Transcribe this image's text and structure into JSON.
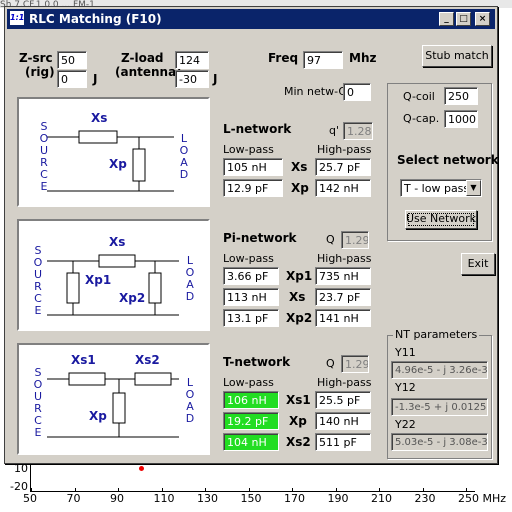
{
  "background": {
    "top_text": "Sh.7.CF.1.0.0 ... FM-1",
    "y_ticks": [
      "10",
      "-20"
    ],
    "x_ticks": [
      "50",
      "70",
      "90",
      "110",
      "130",
      "150",
      "170",
      "190",
      "210",
      "230",
      "250 MHz"
    ]
  },
  "window": {
    "title": "RLC Matching (F10)",
    "min": "_",
    "max": "□",
    "close": "×"
  },
  "zsrc": {
    "label1": "Z-src",
    "label2": "(rig)",
    "r": "50",
    "x": "0",
    "j": "J"
  },
  "zload": {
    "label1": "Z-load",
    "label2": "(antenna)",
    "r": "124",
    "x": "-30",
    "j": "J"
  },
  "freq": {
    "label": "Freq",
    "value": "97",
    "unit": "Mhz"
  },
  "minq": {
    "label": "Min netw-Q",
    "value": "0"
  },
  "stub": "Stub match",
  "qcoil": {
    "label": "Q-coil",
    "value": "250"
  },
  "qcap": {
    "label": "Q-cap.",
    "value": "1000"
  },
  "selnet": {
    "label": "Select network",
    "value": "T - low pass",
    "btn": "Use Network"
  },
  "exit": "Exit",
  "lnet": {
    "title": "L-network",
    "qlabel": "q'",
    "q": "1.28",
    "low": "Low-pass",
    "high": "High-pass",
    "r1": {
      "lo": "105 nH",
      "name": "Xs",
      "hi": "25.7 pF"
    },
    "r2": {
      "lo": "12.9 pF",
      "name": "Xp",
      "hi": "142 nH"
    },
    "d": {
      "src": "SOURCE",
      "load": "LOAD",
      "xs": "Xs",
      "xp": "Xp"
    }
  },
  "pinet": {
    "title": "Pi-network",
    "qlabel": "Q",
    "q": "1.29",
    "low": "Low-pass",
    "high": "High-pass",
    "r1": {
      "lo": "3.66 pF",
      "name": "Xp1",
      "hi": "735 nH"
    },
    "r2": {
      "lo": "113 nH",
      "name": "Xs",
      "hi": "23.7 pF"
    },
    "r3": {
      "lo": "13.1 pF",
      "name": "Xp2",
      "hi": "141 nH"
    },
    "d": {
      "src": "SOURCE",
      "load": "LOAD",
      "xs": "Xs",
      "xp1": "Xp1",
      "xp2": "Xp2"
    }
  },
  "tnet": {
    "title": "T-network",
    "qlabel": "Q",
    "q": "1.29",
    "low": "Low-pass",
    "high": "High-pass",
    "r1": {
      "lo": "106 nH",
      "name": "Xs1",
      "hi": "25.5 pF"
    },
    "r2": {
      "lo": "19.2 pF",
      "name": "Xp",
      "hi": "140 nH"
    },
    "r3": {
      "lo": "104 nH",
      "name": "Xs2",
      "hi": "511 pF"
    },
    "d": {
      "src": "SOURCE",
      "load": "LOAD",
      "xs1": "Xs1",
      "xs2": "Xs2",
      "xp": "Xp"
    }
  },
  "ntparams": {
    "title": "NT parameters",
    "y11": "Y11",
    "y11v": "4.96e-5 - j 3.26e-3",
    "y12": "Y12",
    "y12v": "-1.3e-5 + j 0.0125",
    "y22": "Y22",
    "y22v": "5.03e-5 - j 3.08e-3"
  }
}
